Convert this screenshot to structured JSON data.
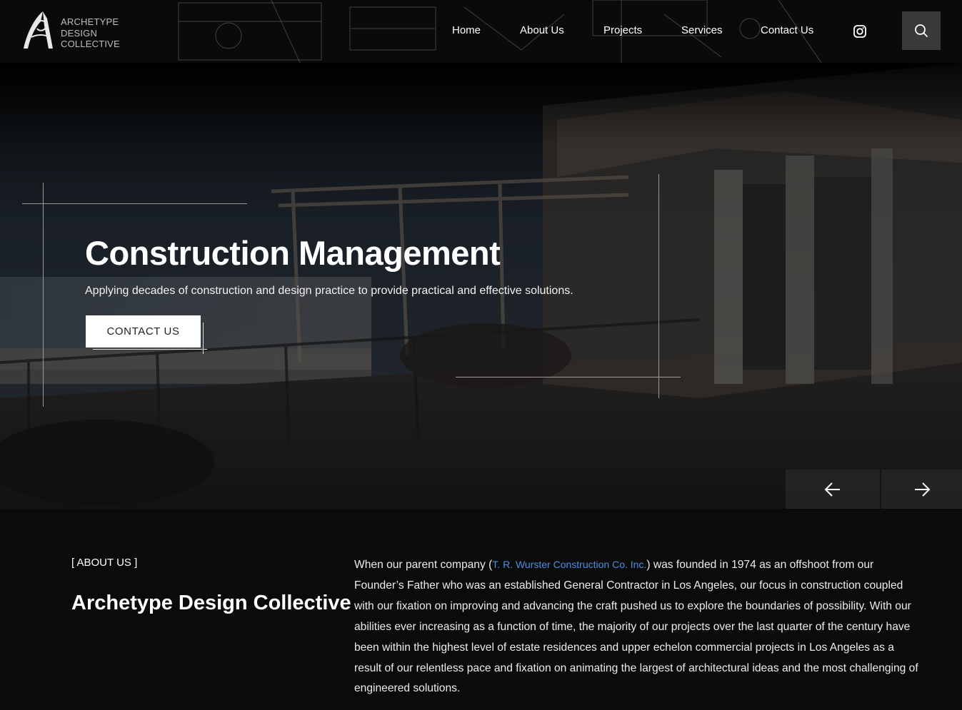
{
  "logo": {
    "line1": "ARCHETYPE",
    "line2": "DESIGN",
    "line3": "COLLECTIVE"
  },
  "nav": {
    "items": [
      {
        "label": "Home"
      },
      {
        "label": "About Us"
      },
      {
        "label": "Projects"
      },
      {
        "label": "Services"
      },
      {
        "label": "Contact Us"
      }
    ]
  },
  "icons": {
    "social": "instagram-icon",
    "search": "search-icon",
    "prev": "arrow-left-icon",
    "next": "arrow-right-icon"
  },
  "hero": {
    "title": "Construction Management",
    "subtitle": "Applying decades of construction and design practice to provide practical and effective solutions.",
    "cta_label": "CONTACT US"
  },
  "about": {
    "label": "[ ABOUT US ]",
    "heading": "Archetype Design Collective",
    "text_before_link": "When our parent company (",
    "link_text": "T. R. Wurster Construction Co. Inc.",
    "text_after_link": ") was founded in 1974 as an offshoot from our Founder’s Father who was an established General Contractor in Los Angeles, our focus in construction coupled with our fixation on improving and advancing the craft pushed us to explore the boundaries of possibility. With our abilities ever increasing as a function of time, the majority of our projects over the last quarter of the century have been within the highest level of estate residences and upper echelon commercial projects in Los Angeles as a result of our relentless pace and fixation on animating the largest of architectural ideas and the most challenging of engineered solutions."
  },
  "colors": {
    "background": "#0b0b0c",
    "link": "#4a8fe0",
    "search_button": "#3a3a3c"
  }
}
